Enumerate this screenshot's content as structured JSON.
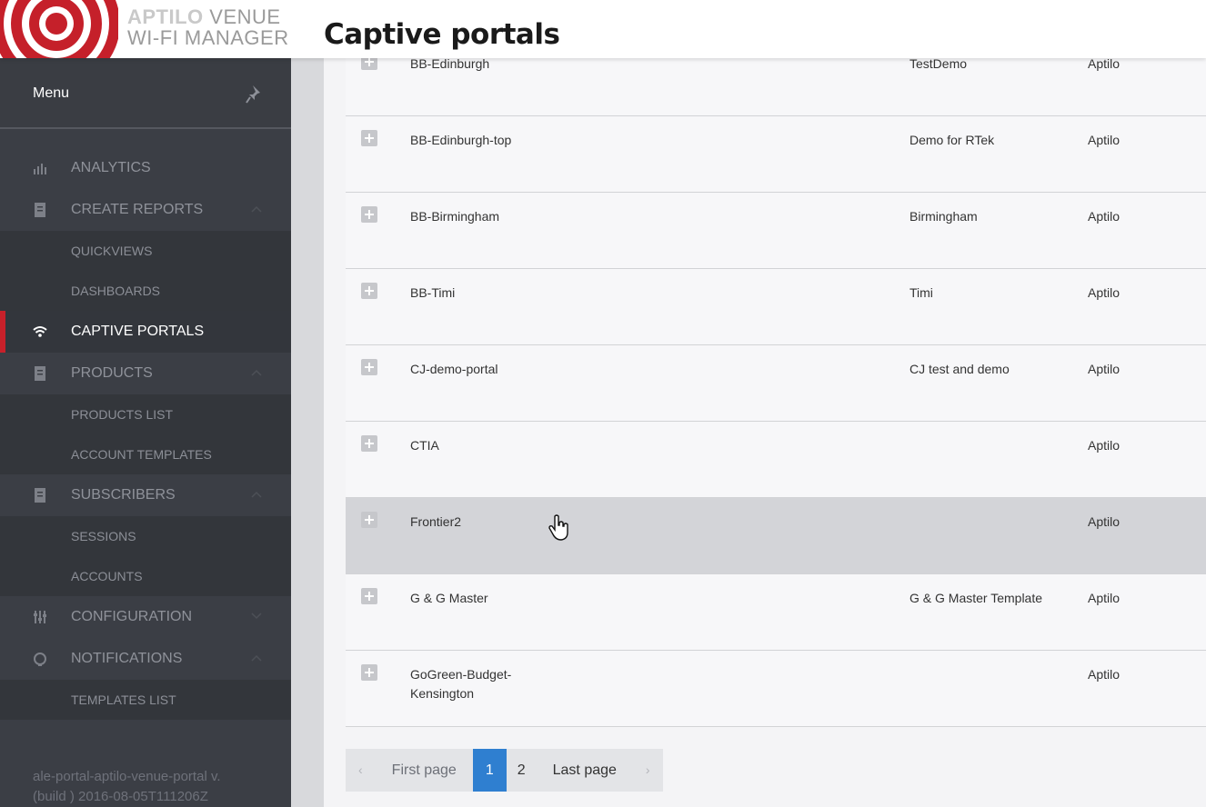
{
  "header": {
    "brand": "APTILO",
    "brand_rest": " VENUE",
    "brand_line2": "WI-FI MANAGER",
    "page_title": "Captive portals"
  },
  "sidebar": {
    "menu_title": "Menu",
    "items": [
      {
        "label": "ANALYTICS",
        "icon": "bar-chart-icon"
      },
      {
        "label": "CREATE REPORTS",
        "icon": "report-icon",
        "sub": [
          "QUICKVIEWS",
          "DASHBOARDS"
        ]
      },
      {
        "label": "CAPTIVE PORTALS",
        "icon": "wifi-icon",
        "active": true
      },
      {
        "label": "PRODUCTS",
        "icon": "product-icon",
        "sub": [
          "PRODUCTS LIST",
          "ACCOUNT TEMPLATES"
        ]
      },
      {
        "label": "SUBSCRIBERS",
        "icon": "subscriber-icon",
        "sub": [
          "SESSIONS",
          "ACCOUNTS"
        ]
      },
      {
        "label": "CONFIGURATION",
        "icon": "sliders-icon"
      },
      {
        "label": "NOTIFICATIONS",
        "icon": "bell-icon",
        "sub": [
          "TEMPLATES LIST"
        ]
      }
    ],
    "version_line1": "ale-portal-aptilo-venue-portal v.",
    "version_line2": "(build ) 2016-08-05T111206Z"
  },
  "table": {
    "rows": [
      {
        "name": "BB-Edinburgh",
        "description": "TestDemo",
        "owner": "Aptilo"
      },
      {
        "name": "BB-Edinburgh-top",
        "description": "Demo for RTek",
        "owner": "Aptilo"
      },
      {
        "name": "BB-Birmingham",
        "description": "Birmingham",
        "owner": "Aptilo"
      },
      {
        "name": "BB-Timi",
        "description": "Timi",
        "owner": "Aptilo"
      },
      {
        "name": "CJ-demo-portal",
        "description": "CJ test and demo",
        "owner": "Aptilo"
      },
      {
        "name": "CTIA",
        "description": "",
        "owner": "Aptilo"
      },
      {
        "name": "Frontier2",
        "description": "",
        "owner": "Aptilo"
      },
      {
        "name": "G & G Master",
        "description": "G & G Master Template",
        "owner": "Aptilo"
      },
      {
        "name": "GoGreen-Budget-Kensington",
        "description": "",
        "owner": "Aptilo"
      }
    ]
  },
  "pagination": {
    "prev": "‹",
    "first": "First page",
    "pages": [
      "1",
      "2"
    ],
    "current": "1",
    "last": "Last page",
    "next": "›"
  },
  "colors": {
    "accent_red": "#c8202a",
    "active_page_blue": "#2f7fd0",
    "sidebar_bg": "#3b3e45"
  }
}
